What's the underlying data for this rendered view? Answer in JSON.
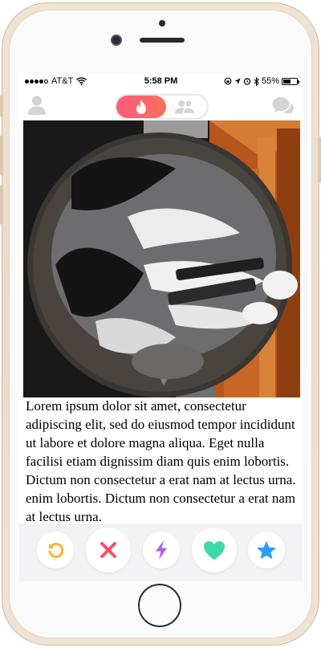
{
  "status_bar": {
    "carrier": "AT&T",
    "time": "5:58 PM",
    "battery": "55%",
    "battery_level": 0.55,
    "signal_bars_filled": 4
  },
  "header": {
    "left_icon": "profile-icon",
    "mode_toggle": {
      "active": "flame-icon",
      "inactive": "people-icon"
    },
    "right_icon": "chat-bubbles-icon"
  },
  "card": {
    "photo_icon": "cat-photo",
    "bio": "Lorem ipsum dolor sit amet, consectetur adipiscing elit, sed do eiusmod tempor incididunt ut labore et dolore magna aliqua. Eget nulla facilisi etiam dignissim diam quis enim lobortis. Dictum non consectetur a erat nam at lectus urna. enim lobortis. Dictum non consectetur a erat nam at lectus urna."
  },
  "actions": [
    {
      "name": "rewind",
      "icon": "rewind-icon",
      "color": "#f5b821"
    },
    {
      "name": "nope",
      "icon": "close-icon",
      "color": "#fd4e67"
    },
    {
      "name": "boost",
      "icon": "lightning-icon",
      "color": "#a95ef1"
    },
    {
      "name": "like",
      "icon": "heart-icon",
      "color": "#3ed9a8"
    },
    {
      "name": "super-like",
      "icon": "star-icon",
      "color": "#2d9df4"
    }
  ],
  "colors": {
    "brand_gradient_start": "#fd5d7c",
    "brand_gradient_end": "#fe6f58",
    "inactive_icon": "#d4d4d8"
  }
}
